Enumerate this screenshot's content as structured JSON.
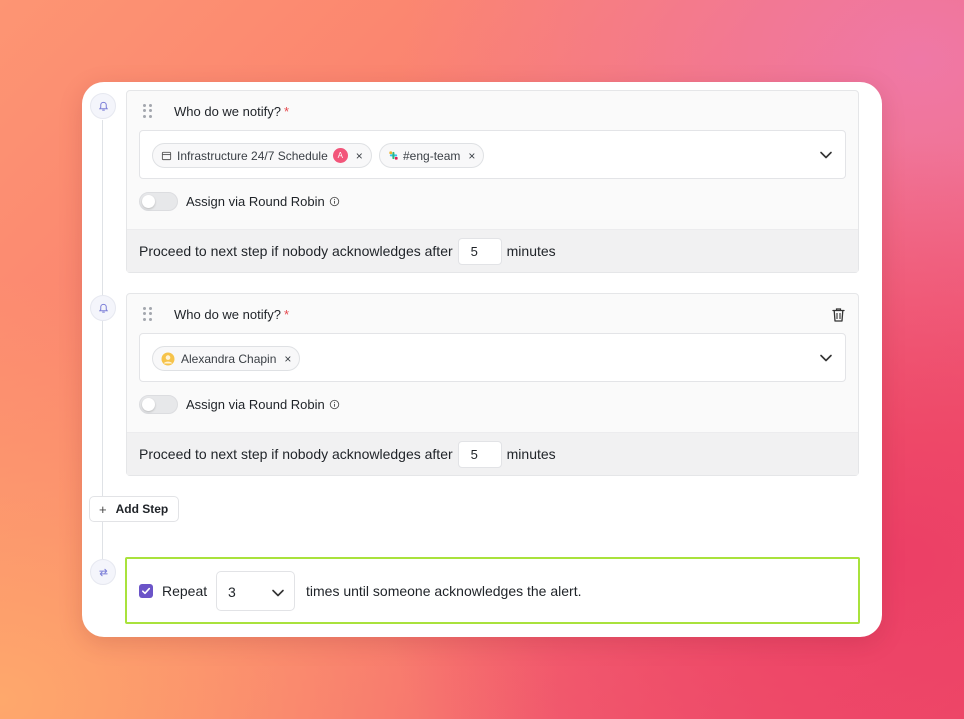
{
  "steps": [
    {
      "title": "Who do we notify?",
      "required_mark": "*",
      "recipients": [
        {
          "label": "Infrastructure 24/7 Schedule",
          "icon": "calendar-icon",
          "badge": "A",
          "remove": "×"
        },
        {
          "label": "#eng-team",
          "icon": "slack-icon",
          "remove": "×"
        }
      ],
      "round_robin_label": "Assign via Round Robin",
      "round_robin_enabled": false,
      "proceed_prefix": "Proceed to next step if nobody acknowledges after",
      "minutes_value": "5",
      "minutes_suffix": "minutes"
    },
    {
      "title": "Who do we notify?",
      "required_mark": "*",
      "recipients": [
        {
          "label": "Alexandra Chapin",
          "icon": "user-avatar-icon",
          "remove": "×"
        }
      ],
      "round_robin_label": "Assign via Round Robin",
      "round_robin_enabled": false,
      "proceed_prefix": "Proceed to next step if nobody acknowledges after",
      "minutes_value": "5",
      "minutes_suffix": "minutes"
    }
  ],
  "add_step": {
    "plus": "+",
    "label": "Add Step"
  },
  "repeat": {
    "checked": true,
    "label": "Repeat",
    "count": "3",
    "suffix": "times until someone acknowledges the alert."
  },
  "colors": {
    "accent_purple": "#6b54c8",
    "highlight_green": "#a9e23c",
    "required_red": "#e5484d"
  }
}
